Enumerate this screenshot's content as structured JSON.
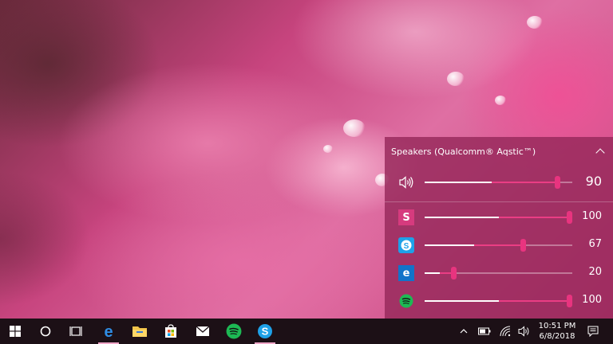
{
  "flyout": {
    "device_name": "Speakers (Qualcomm® Aqstic™)",
    "master": {
      "icon": "speaker-icon",
      "value": "90",
      "level": 0.9
    },
    "apps": [
      {
        "name": "s-app",
        "icon": "s-app-icon",
        "glyph": "S",
        "color": "#d63b7e",
        "value": "100",
        "level": 1.0
      },
      {
        "name": "skype",
        "icon": "skype-icon",
        "glyph": "S",
        "color": "#1ea1e8",
        "value": "67",
        "level": 0.67
      },
      {
        "name": "edge",
        "icon": "edge-icon",
        "glyph": "e",
        "color": "#1273c9",
        "value": "20",
        "level": 0.2
      },
      {
        "name": "spotify",
        "icon": "spotify-icon",
        "glyph": "",
        "color": "#1db954",
        "value": "100",
        "level": 1.0
      }
    ]
  },
  "taskbar": {
    "pinned": [
      "windows-start-icon",
      "cortana-icon",
      "task-view-icon",
      "edge-icon",
      "file-explorer-icon",
      "store-icon",
      "mail-icon",
      "spotify-icon",
      "skype-icon"
    ],
    "clock": {
      "time": "10:51 PM",
      "date": "6/8/2018"
    }
  },
  "colors": {
    "accent": "#e8347f",
    "flyout_bg": "#96285a",
    "taskbar_bg": "#1c1016"
  }
}
